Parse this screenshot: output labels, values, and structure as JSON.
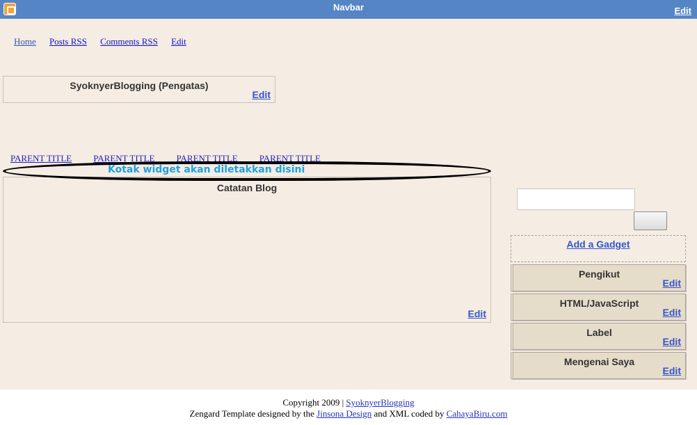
{
  "navbar": {
    "title": "Navbar",
    "edit": "Edit"
  },
  "links": [
    "Home",
    "Posts RSS",
    "Comments RSS",
    "Edit"
  ],
  "header_widget": {
    "title": "SyoknyerBlogging (Pengatas)",
    "edit": "Edit"
  },
  "parent_titles": [
    "PARENT TITLE",
    "PARENT TITLE",
    "PARENT TITLE",
    "PARENT TITLE"
  ],
  "annotation": "Kotak widget akan diletakkan disini",
  "blog_widget": {
    "title": "Catatan Blog",
    "edit": "Edit"
  },
  "sidebar": {
    "add_gadget": "Add a Gadget",
    "gadgets": [
      {
        "title": "Pengikut",
        "edit": "Edit"
      },
      {
        "title": "HTML/JavaScript",
        "edit": "Edit"
      },
      {
        "title": "Label",
        "edit": "Edit"
      },
      {
        "title": "Mengenai Saya",
        "edit": "Edit"
      }
    ]
  },
  "footer": {
    "copyright": "Copyright 2009 |",
    "blog_link": "SyoknyerBlogging",
    "designed_prefix": "Zengard Template designed by the",
    "designer_link": "Jinsona Design",
    "coded_text": "and XML coded by",
    "coder_link": "CahayaBiru.com"
  },
  "colors": {
    "navbar": "#5585c5",
    "background": "#f5ece3",
    "annotation": "#1aa3e0",
    "gadget": "#e6dcca"
  }
}
